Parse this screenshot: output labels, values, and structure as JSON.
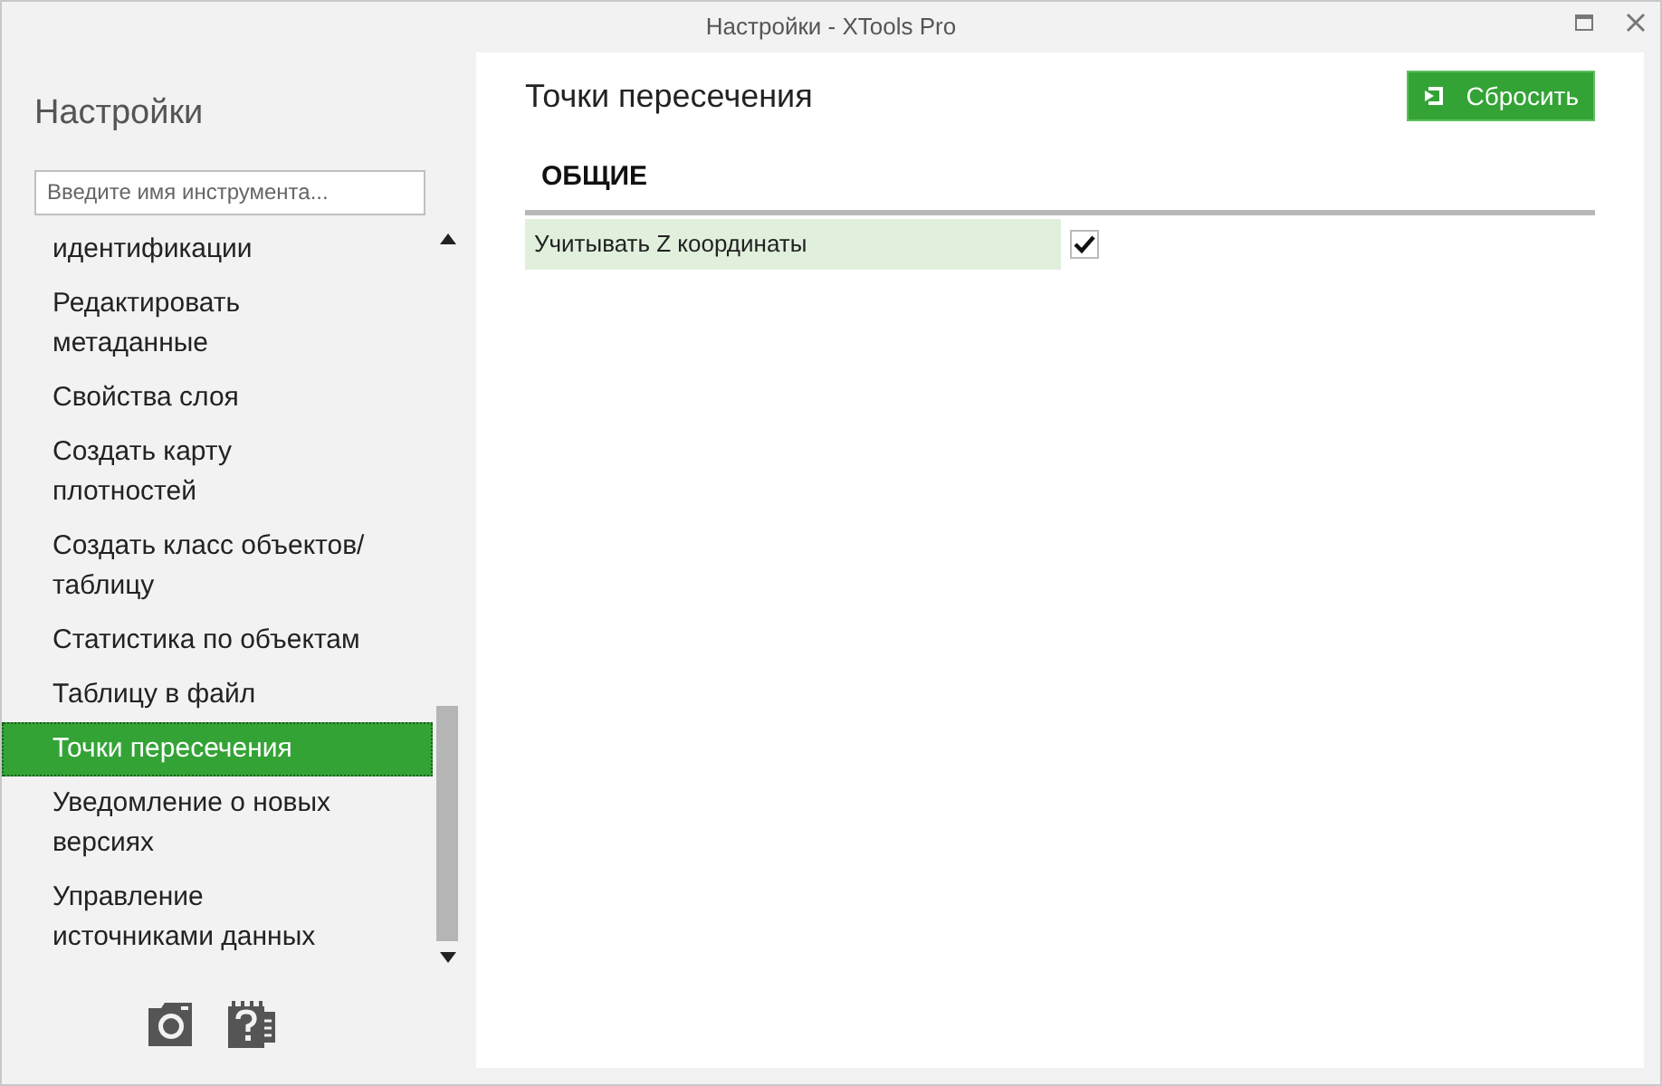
{
  "window": {
    "title": "Настройки - XTools Pro"
  },
  "sidebar": {
    "title": "Настройки",
    "search": {
      "placeholder": "Введите имя инструмента..."
    },
    "items": [
      {
        "label": "идентификации",
        "selected": false
      },
      {
        "label": "Редактировать метаданные",
        "selected": false
      },
      {
        "label": "Свойства слоя",
        "selected": false
      },
      {
        "label": "Создать карту плотностей",
        "selected": false
      },
      {
        "label": "Создать класс объектов/ таблицу",
        "selected": false
      },
      {
        "label": "Статистика по объектам",
        "selected": false
      },
      {
        "label": "Таблицу в файл",
        "selected": false
      },
      {
        "label": "Точки пересечения",
        "selected": true
      },
      {
        "label": "Уведомление о новых версиях",
        "selected": false
      },
      {
        "label": "Управление источниками данных",
        "selected": false
      }
    ]
  },
  "content": {
    "title": "Точки пересечения",
    "reset_button": "Сбросить",
    "sections": [
      {
        "title": "ОБЩИЕ",
        "settings": [
          {
            "label": "Учитывать Z координаты",
            "checked": true
          }
        ]
      }
    ]
  }
}
